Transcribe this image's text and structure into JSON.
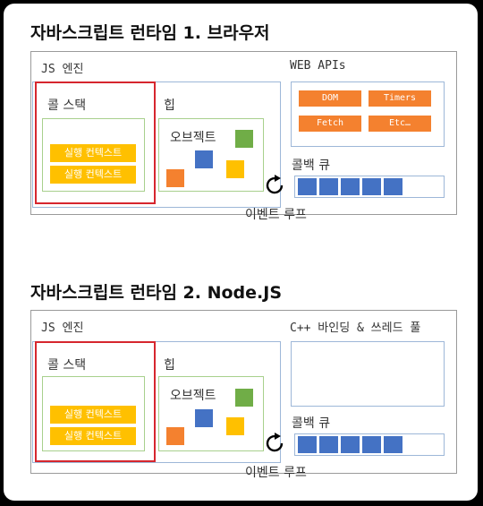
{
  "colors": {
    "green": "#70ad47",
    "blue": "#4472c4",
    "orange": "#f4812f",
    "yellow": "#ffc000",
    "red": "#d6262e"
  },
  "runtime1": {
    "title": "자바스크립트 런타임 1. 브라우저",
    "engine_label": "JS 엔진",
    "call_stack_label": "콜 스택",
    "contexts": [
      "실행 컨텍스트",
      "실행 컨텍스트"
    ],
    "heap_label": "힙",
    "objects_label": "오브젝트",
    "apis_label": "WEB APIs",
    "apis": [
      "DOM",
      "Timers",
      "Fetch",
      "Etc…"
    ],
    "queue_label": "콜백 큐",
    "event_loop_label": "이벤트 루프"
  },
  "runtime2": {
    "title": "자바스크립트 런타임 2. Node.JS",
    "engine_label": "JS 엔진",
    "call_stack_label": "콜 스택",
    "contexts": [
      "실행 컨텍스트",
      "실행 컨텍스트"
    ],
    "heap_label": "힙",
    "objects_label": "오브젝트",
    "apis_label": "C++ 바인딩 & 쓰레드 풀",
    "queue_label": "콜백 큐",
    "event_loop_label": "이벤트 루프"
  }
}
